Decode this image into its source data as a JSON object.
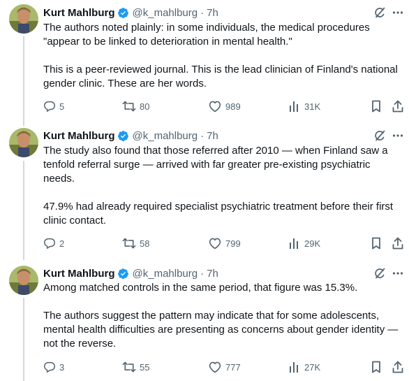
{
  "tweets": [
    {
      "author": "Kurt Mahlburg",
      "handle": "@k_mahlburg",
      "separator": "·",
      "time": "7h",
      "paragraphs": [
        "The authors noted plainly: in some individuals, the medical procedures \"appear to be linked to deterioration in mental health.\"",
        "This is a peer-reviewed journal. This is the lead clinician of Finland's national gender clinic. These are her words."
      ],
      "replies": "5",
      "reposts": "80",
      "likes": "989",
      "views": "31K"
    },
    {
      "author": "Kurt Mahlburg",
      "handle": "@k_mahlburg",
      "separator": "·",
      "time": "7h",
      "paragraphs": [
        "The study also found that those referred after 2010 — when Finland saw a tenfold referral surge — arrived with far greater pre-existing psychiatric needs.",
        "47.9% had already required specialist psychiatric treatment before their first clinic contact."
      ],
      "replies": "2",
      "reposts": "58",
      "likes": "799",
      "views": "29K"
    },
    {
      "author": "Kurt Mahlburg",
      "handle": "@k_mahlburg",
      "separator": "·",
      "time": "7h",
      "paragraphs": [
        "Among matched controls in the same period, that figure was 15.3%.",
        "The authors suggest the pattern may indicate that for some adolescents, mental health difficulties are presenting as concerns about gender identity — not the reverse."
      ],
      "replies": "3",
      "reposts": "55",
      "likes": "777",
      "views": "27K"
    }
  ],
  "colors": {
    "text": "#0f1419",
    "secondary": "#536471",
    "verified": "#1d9bf0",
    "thread_line": "#cfd9de"
  },
  "icons": [
    "avatar-photo",
    "verified-badge-icon",
    "grok-icon",
    "more-icon",
    "reply-icon",
    "repost-icon",
    "like-icon",
    "views-icon",
    "bookmark-icon",
    "share-icon"
  ]
}
